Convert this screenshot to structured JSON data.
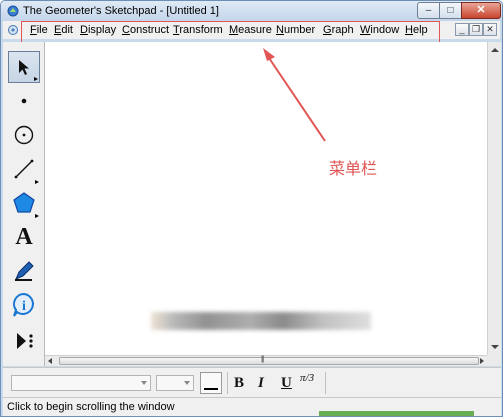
{
  "window": {
    "title": "The Geometer's Sketchpad - [Untitled 1]",
    "controls": {
      "minimize": "–",
      "maximize": "□",
      "close": "✕"
    }
  },
  "menubar": {
    "items": [
      {
        "label": "File",
        "mnemonic": "F",
        "rest": "ile"
      },
      {
        "label": "Edit",
        "mnemonic": "E",
        "rest": "dit"
      },
      {
        "label": "Display",
        "mnemonic": "D",
        "rest": "isplay"
      },
      {
        "label": "Construct",
        "mnemonic": "C",
        "rest": "onstruct"
      },
      {
        "label": "Transform",
        "mnemonic": "T",
        "rest": "ransform"
      },
      {
        "label": "Measure",
        "mnemonic": "M",
        "rest": "easure"
      },
      {
        "label": "Number",
        "mnemonic": "N",
        "rest": "umber"
      },
      {
        "label": "Graph",
        "mnemonic": "G",
        "rest": "raph"
      },
      {
        "label": "Window",
        "mnemonic": "W",
        "rest": "indow"
      },
      {
        "label": "Help",
        "mnemonic": "H",
        "rest": "elp"
      }
    ],
    "mdi_controls": {
      "minimize": "_",
      "restore": "❐",
      "close": "✕"
    }
  },
  "toolbox": {
    "tools": [
      {
        "name": "selection-arrow-tool",
        "icon": "arrow-icon",
        "active": true
      },
      {
        "name": "point-tool",
        "icon": "point-icon"
      },
      {
        "name": "compass-tool",
        "icon": "compass-circle-icon"
      },
      {
        "name": "straightedge-tool",
        "icon": "line-segment-icon"
      },
      {
        "name": "polygon-tool",
        "icon": "pentagon-icon"
      },
      {
        "name": "text-tool",
        "icon": "text-a-icon",
        "glyph": "A"
      },
      {
        "name": "marker-tool",
        "icon": "pen-marker-icon"
      },
      {
        "name": "information-tool",
        "icon": "info-icon",
        "glyph": "i"
      },
      {
        "name": "custom-tool",
        "icon": "play-custom-icon"
      }
    ]
  },
  "annotation": {
    "label": "菜单栏",
    "color": "#e25555"
  },
  "formatbar": {
    "bold": "B",
    "italic": "I",
    "underline": "U",
    "math_format": "π/3"
  },
  "statusbar": {
    "text": "Click to begin scrolling the window"
  },
  "colors": {
    "titlebar": "#c9daeb",
    "annotation_red": "#e25555",
    "polygon_blue": "#1e88e5",
    "info_blue": "#1976d2"
  }
}
